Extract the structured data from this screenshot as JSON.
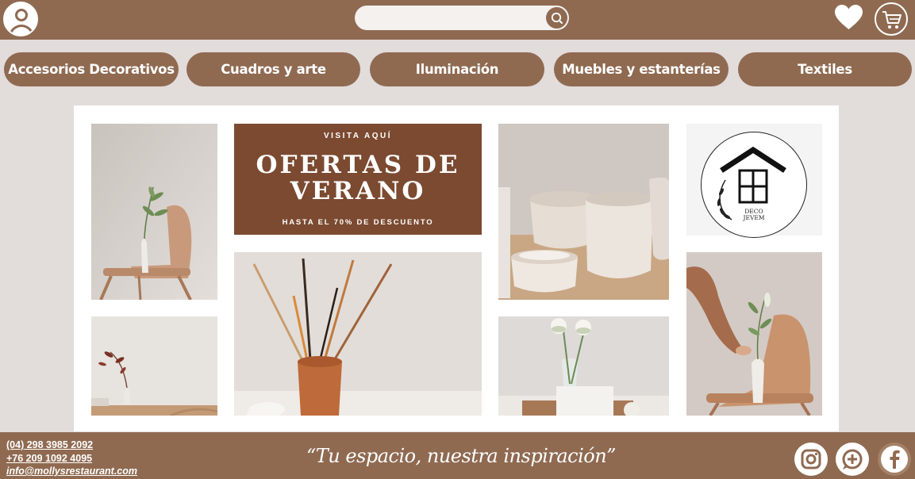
{
  "header": {
    "search": {
      "placeholder": ""
    }
  },
  "nav": {
    "items": [
      {
        "label": "Accesorios Decorativos"
      },
      {
        "label": "Cuadros y arte"
      },
      {
        "label": "Iluminación"
      },
      {
        "label": "Muebles y estanterías"
      },
      {
        "label": "Textiles"
      }
    ]
  },
  "promo": {
    "kicker": "VISITA AQUÍ",
    "title_line1": "OFERTAS DE",
    "title_line2": "VERANO",
    "subtitle": "HASTA EL 70% DE DESCUENTO"
  },
  "logo": {
    "line1": "DECO",
    "line2": "JEVEM"
  },
  "footer": {
    "phone1": "(04) 298 3985 2092",
    "phone2": "+76 209 1092 4095",
    "email": "info@mollysrestaurant.com",
    "slogan": "“Tu espacio, nuestra inspiración”"
  },
  "icons": {
    "avatar": "user-icon",
    "search": "search-icon",
    "favorites": "heart-icon",
    "cart": "cart-icon",
    "instagram": "instagram-icon",
    "add": "add-icon",
    "facebook": "facebook-icon"
  },
  "colors": {
    "brand": "#8f6a51",
    "promo": "#7b4a31",
    "background": "#e2dcdb"
  }
}
